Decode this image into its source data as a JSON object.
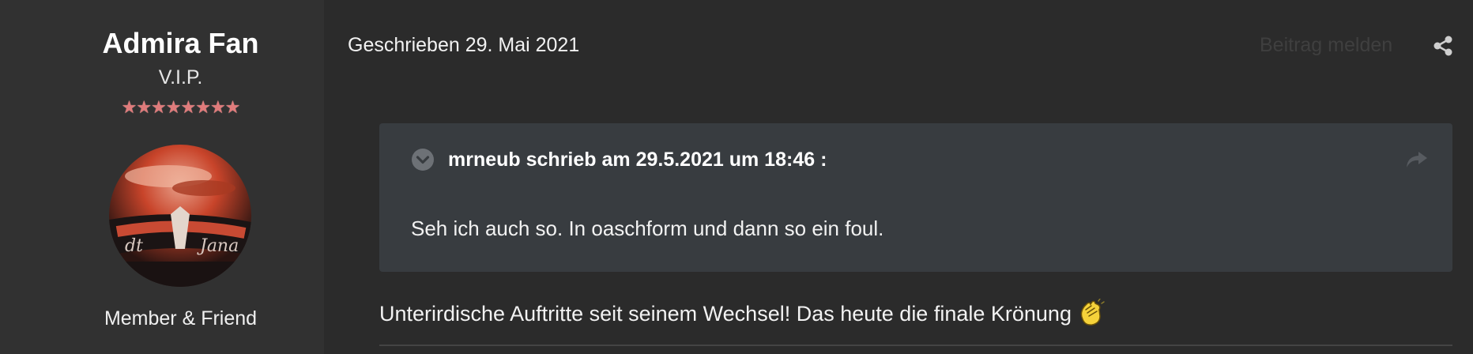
{
  "author": {
    "name": "Admira Fan",
    "rank": "V.I.P.",
    "stars": "★★★★★★★★",
    "group": "Member & Friend"
  },
  "post": {
    "date": "Geschrieben 29. Mai 2021",
    "report_label": "Beitrag melden",
    "quote": {
      "citation": "mrneub schrieb am 29.5.2021 um 18:46 :",
      "text": "Seh ich auch so. In oaschform und dann so ein foul."
    },
    "body": "Unterirdische Auftritte seit seinem Wechsel! Das heute die finale Krönung"
  },
  "icons": {
    "share": "share-icon",
    "quote_toggle": "chevron-down-icon",
    "quote_forward": "forward-arrow-icon",
    "emoji": "clapping-hands-icon"
  },
  "colors": {
    "background": "#2b2b2b",
    "sidebar": "#313131",
    "quote_bg": "#383c40",
    "stars": "#e07b7b"
  }
}
